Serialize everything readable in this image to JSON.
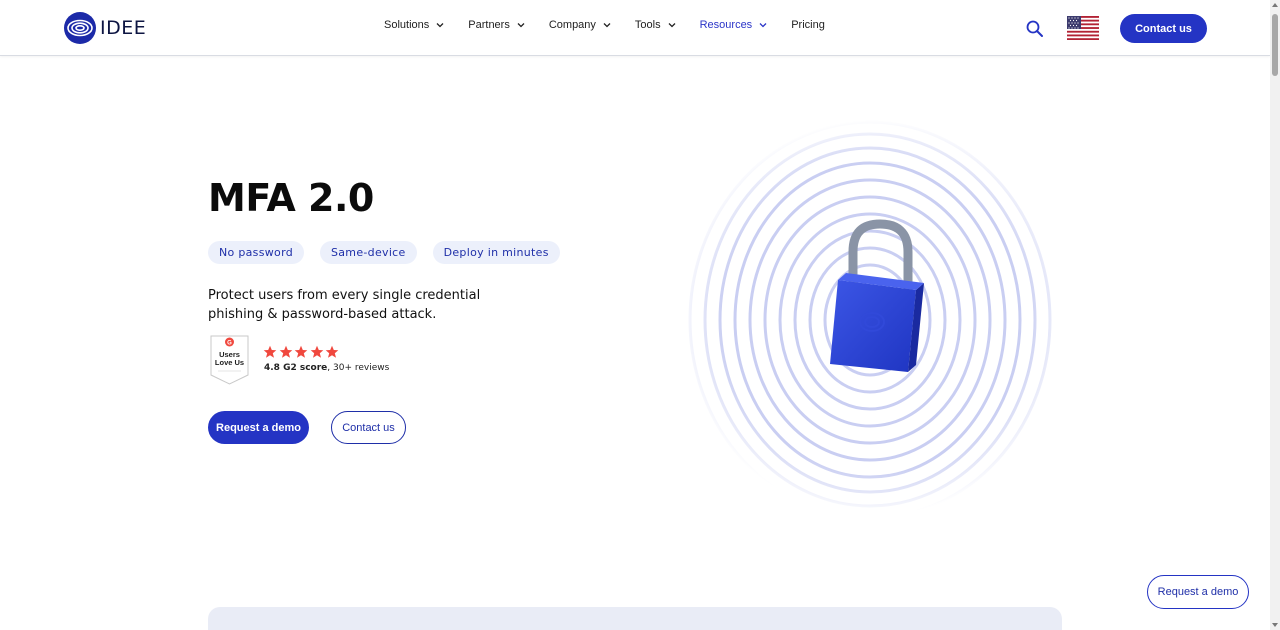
{
  "header": {
    "logo_text": "IDEE",
    "nav": [
      {
        "label": "Solutions",
        "active": false
      },
      {
        "label": "Partners",
        "active": false
      },
      {
        "label": "Company",
        "active": false
      },
      {
        "label": "Tools",
        "active": false
      },
      {
        "label": "Resources",
        "active": true
      },
      {
        "label": "Pricing",
        "active": false
      }
    ],
    "contact_label": "Contact us",
    "icons": [
      "idee-logo-icon",
      "chevron-down-icon",
      "search-icon",
      "us-flag-icon"
    ]
  },
  "hero": {
    "title": "MFA 2.0",
    "chips": [
      "No password",
      "Same-device",
      "Deploy in minutes"
    ],
    "description": "Protect users from every single credential phishing & password-based attack.",
    "badge": {
      "line1": "Users",
      "line2": "Love Us"
    },
    "rating": {
      "stars": 5,
      "score": "4.8 G2 score",
      "reviews": ", 30+ reviews"
    },
    "primary_button": "Request a demo",
    "secondary_button": "Contact us"
  },
  "floating_button": "Request a demo",
  "colors": {
    "brand": "#2434c4",
    "chip_bg": "#ecf0fb",
    "star": "#f0483e",
    "text": "#111111"
  }
}
